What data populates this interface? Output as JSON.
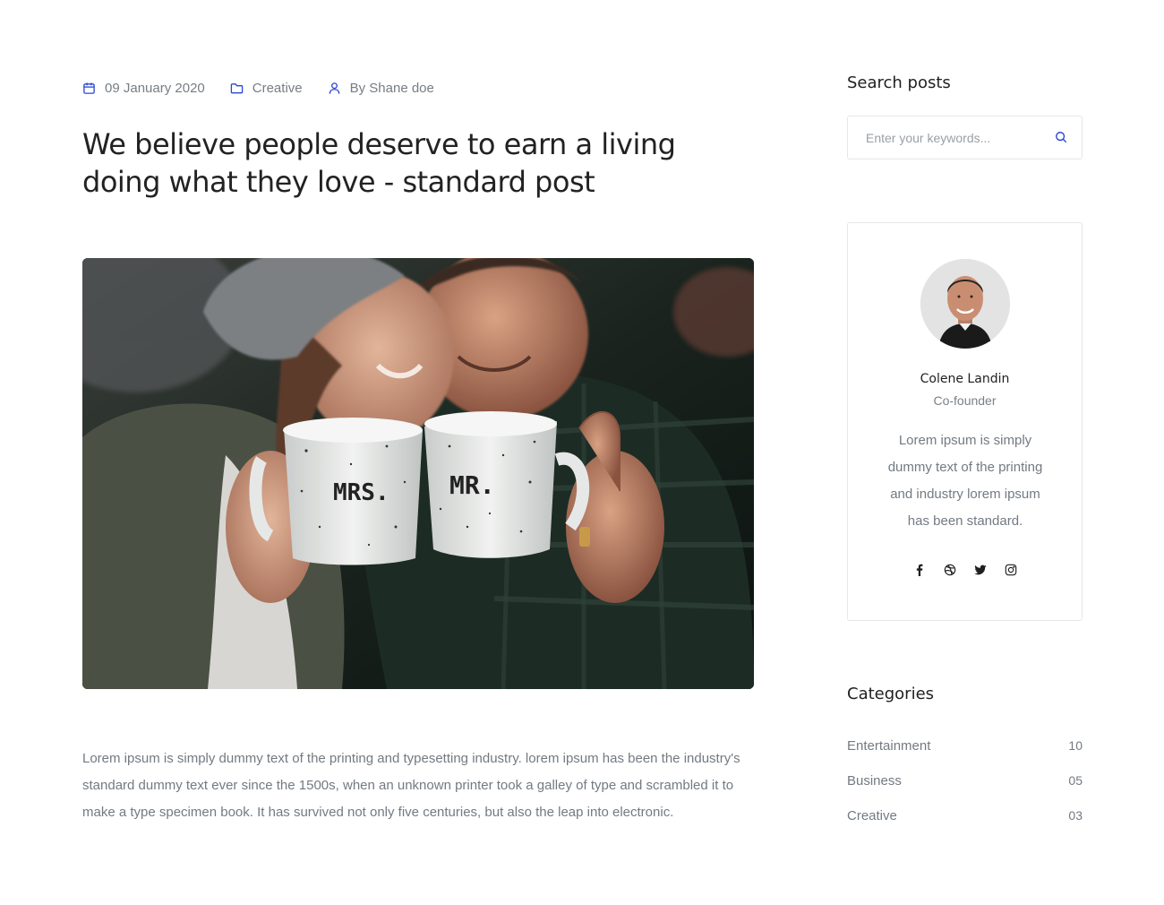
{
  "post": {
    "date": "09 January 2020",
    "category": "Creative",
    "author": "By Shane doe",
    "title": "We believe people deserve to earn a living doing what they love - standard post",
    "image": {
      "mug_left_text": "MRS.",
      "mug_right_text": "MR."
    },
    "body": "Lorem ipsum is simply dummy text of the printing and typesetting industry. lorem ipsum has been the industry's standard dummy text ever since the 1500s, when an unknown printer took a galley of type and scrambled it to make a type specimen book. It has survived not only five centuries, but also the leap into electronic."
  },
  "sidebar": {
    "search": {
      "title": "Search posts",
      "placeholder": "Enter your keywords..."
    },
    "author": {
      "name": "Colene Landin",
      "role": "Co-founder",
      "bio": "Lorem ipsum is simply dummy text of the printing and industry lorem ipsum has been standard.",
      "socials": [
        "facebook-icon",
        "dribbble-icon",
        "twitter-icon",
        "instagram-icon"
      ]
    },
    "categories": {
      "title": "Categories",
      "items": [
        {
          "label": "Entertainment",
          "count": "10"
        },
        {
          "label": "Business",
          "count": "05"
        },
        {
          "label": "Creative",
          "count": "03"
        }
      ]
    }
  },
  "colors": {
    "accent": "#2946d3",
    "text": "#737a82",
    "heading": "#222222",
    "border": "#e5e7ea"
  }
}
